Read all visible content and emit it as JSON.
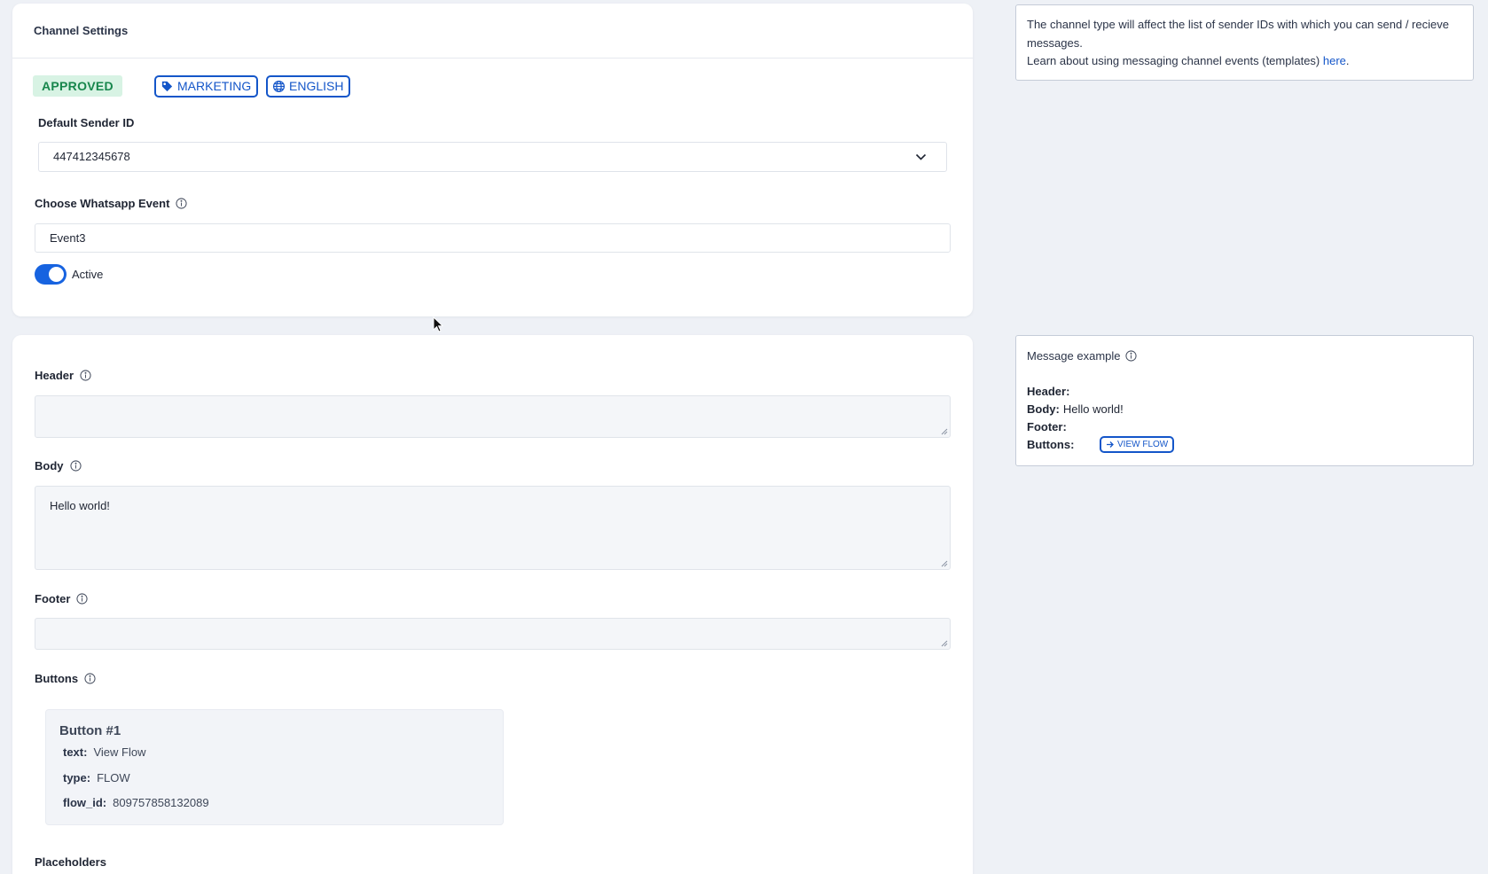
{
  "channel_settings": {
    "title": "Channel Settings",
    "badges": {
      "status": "APPROVED",
      "category": "MARKETING",
      "language": "ENGLISH"
    },
    "default_sender_label": "Default Sender ID",
    "default_sender_value": "447412345678",
    "event_label": "Choose Whatsapp Event",
    "event_value": "Event3",
    "active_label": "Active",
    "active": true
  },
  "template": {
    "header_label": "Header",
    "header_value": "",
    "body_label": "Body",
    "body_value": "Hello world!",
    "footer_label": "Footer",
    "footer_value": "",
    "buttons_label": "Buttons",
    "button_1": {
      "title": "Button #1",
      "text_key": "text:",
      "text_value": "View Flow",
      "type_key": "type:",
      "type_value": "FLOW",
      "flow_id_key": "flow_id:",
      "flow_id_value": "809757858132089"
    },
    "placeholders_label": "Placeholders"
  },
  "info_channel": {
    "line1": "The channel type will affect the list of sender IDs with which you can send / recieve messages.",
    "line2_prefix": "Learn about using messaging channel events (templates) ",
    "link_text": "here",
    "line2_suffix": "."
  },
  "message_example": {
    "title": "Message example",
    "header_key": "Header:",
    "header_value": "",
    "body_key": "Body:",
    "body_value": "Hello world!",
    "footer_key": "Footer:",
    "footer_value": "",
    "buttons_key": "Buttons:",
    "button_chip": "VIEW FLOW"
  },
  "icons": {
    "info": "info-circle-icon",
    "tag": "tag-icon",
    "globe": "globe-icon",
    "chevron": "chevron-down-icon",
    "arrow": "arrow-right-icon",
    "cursor": "mouse-pointer-icon"
  },
  "colors": {
    "accent": "#1456c9",
    "toggle_on": "#1763e0",
    "approved_bg": "#d8f3e4",
    "approved_text": "#17864c",
    "page_bg": "#eef1f6"
  }
}
